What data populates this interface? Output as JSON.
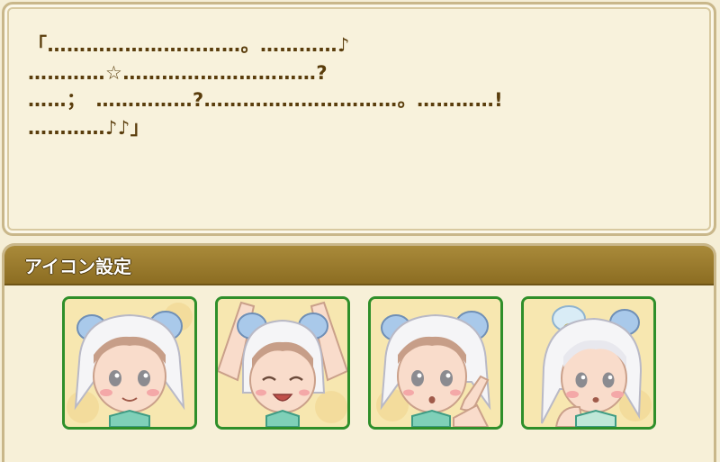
{
  "message": {
    "lines": [
      "「…………………………。…………♪",
      "…………☆…………………………?",
      "……；　……………?…………………………。…………!",
      "…………♪♪」"
    ]
  },
  "icon_settings": {
    "title": "アイコン設定",
    "icons": [
      {
        "expression": "smile"
      },
      {
        "expression": "cheer"
      },
      {
        "expression": "surprised-pointing"
      },
      {
        "expression": "blushing"
      }
    ]
  },
  "colors": {
    "text": "#5a3d0c",
    "header": "#8c6d22",
    "tile_border": "#2f8f2a"
  }
}
